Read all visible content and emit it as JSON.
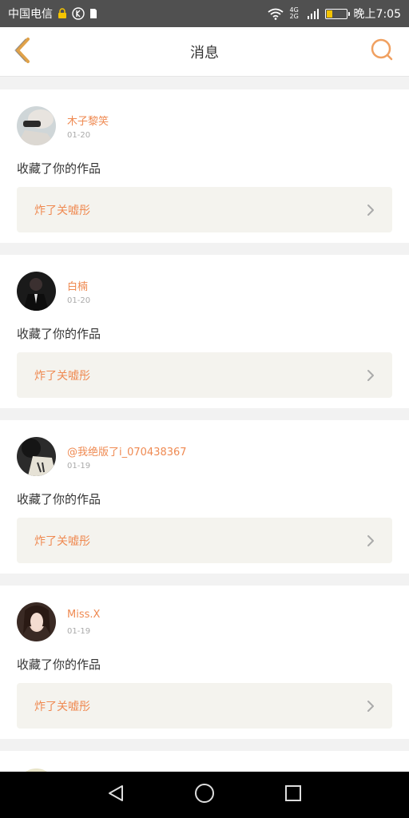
{
  "status_bar": {
    "carrier": "中国电信",
    "network": "4G 2G",
    "time": "晚上7:05",
    "battery_level": 0.3,
    "battery_color": "#f5c400"
  },
  "header": {
    "title": "消息",
    "back_icon": "chevron-left-icon",
    "search_icon": "search-icon",
    "accent": "#e0a24a"
  },
  "notifications": [
    {
      "user": "木子黎笑",
      "date": "01-20",
      "action": "收藏了你的作品",
      "work_title": "炸了关嘘彤"
    },
    {
      "user": "白楠",
      "date": "01-20",
      "action": "收藏了你的作品",
      "work_title": "炸了关嘘彤"
    },
    {
      "user": "@我绝版了i_070438367",
      "date": "01-19",
      "action": "收藏了你的作品",
      "work_title": "炸了关嘘彤"
    },
    {
      "user": "Miss.X",
      "date": "01-19",
      "action": "收藏了你的作品",
      "work_title": "炸了关嘘彤"
    }
  ],
  "colors": {
    "username": "#ef8a52",
    "card_link_bg": "#f4f3ee"
  }
}
